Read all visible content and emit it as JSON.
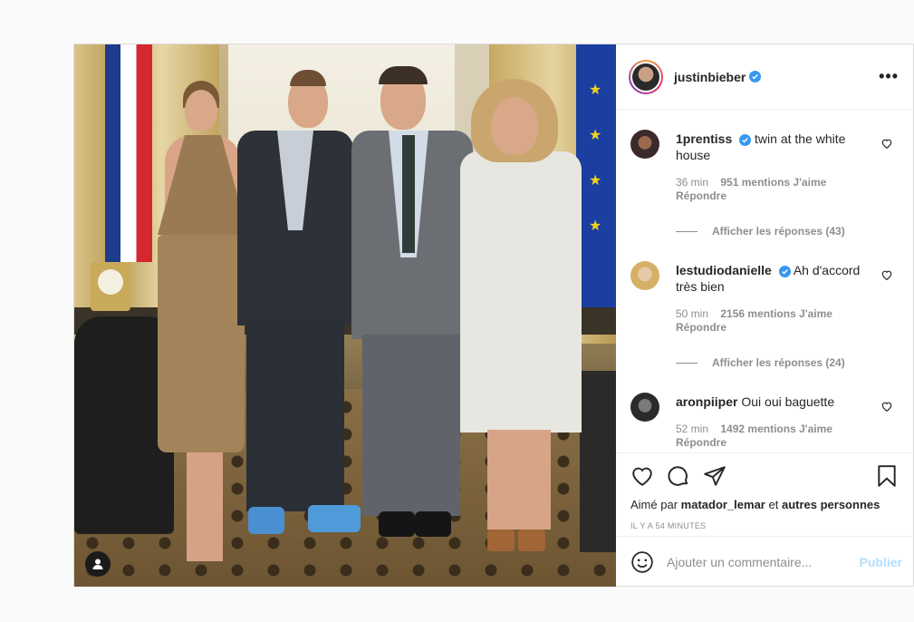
{
  "post": {
    "username": "justinbieber",
    "more_label": "•••",
    "photo_tag_icon": "user-tag-icon"
  },
  "comments": [
    {
      "username": "1prentiss",
      "text": "twin at the white house",
      "time": "36 min",
      "likes": "951 mentions J'aime",
      "reply": "Répondre",
      "show_replies": "Afficher les réponses (43)"
    },
    {
      "username": "lestudiodanielle",
      "text": "Ah d'accord très bien",
      "time": "50 min",
      "likes": "2156 mentions J'aime",
      "reply": "Répondre",
      "show_replies": "Afficher les réponses (24)"
    },
    {
      "username": "aronpiiper",
      "text": "Oui oui baguette",
      "time": "52 min",
      "likes": "1492 mentions J'aime",
      "reply": "Répondre"
    }
  ],
  "actions": {
    "liked_by_prefix": "Aimé par",
    "liked_by_user": "matador_lemar",
    "liked_by_and": "et",
    "liked_by_others": "autres personnes",
    "timestamp": "IL Y A 54 MINUTES"
  },
  "add_comment": {
    "placeholder": "Ajouter un commentaire...",
    "publish_label": "Publier"
  },
  "colors": {
    "verified": "#3897f0",
    "publish_disabled": "#b2dffc"
  }
}
